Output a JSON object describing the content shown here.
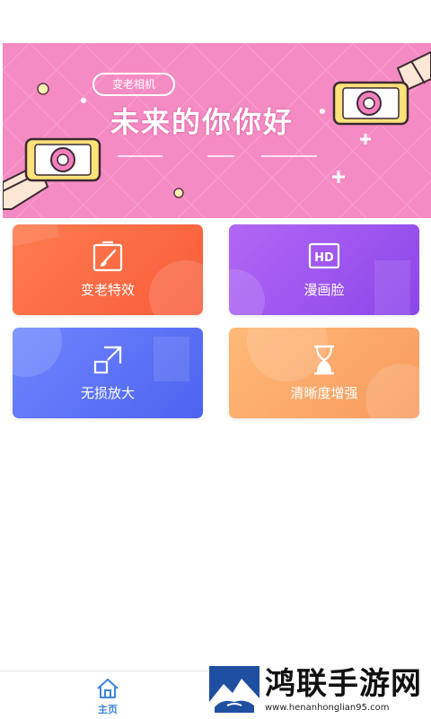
{
  "banner": {
    "tag": "变老相机",
    "slogan": "未来的你你好"
  },
  "features": [
    {
      "label": "变老特效",
      "icon": "portrait-brush-icon"
    },
    {
      "label": "漫画脸",
      "icon": "hd-icon"
    },
    {
      "label": "无损放大",
      "icon": "enlarge-icon"
    },
    {
      "label": "清晰度增强",
      "icon": "hourglass-icon"
    }
  ],
  "tabbar": {
    "home_label": "主页"
  },
  "watermark": {
    "title": "鸿联手游网",
    "url": "www.henanhonglian95.com"
  },
  "colors": {
    "banner_bg": "#f58bc3",
    "card1": "#f86843",
    "card2": "#a25df2",
    "card3": "#5e74f7",
    "card4": "#f9a868",
    "tab_active": "#3b86d8"
  }
}
